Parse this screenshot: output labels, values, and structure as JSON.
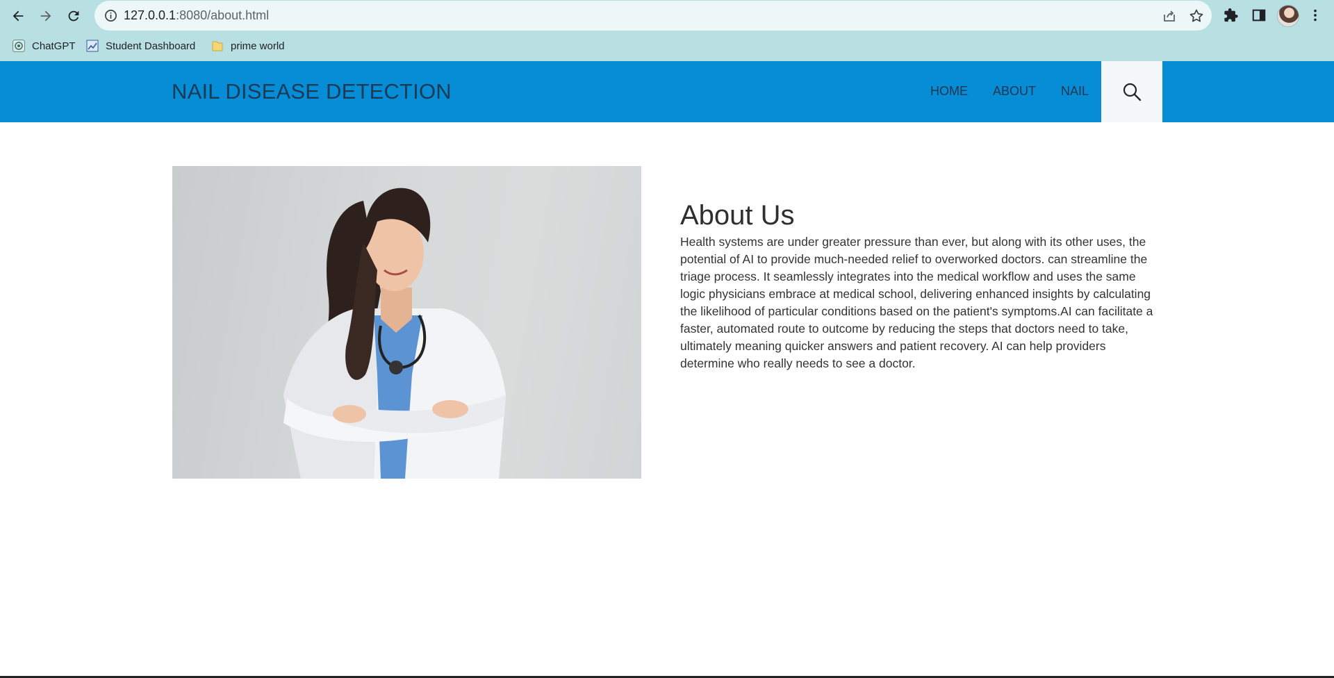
{
  "browser": {
    "url_host": "127.0.0.1",
    "url_path": ":8080/about.html",
    "bookmarks": [
      {
        "label": "ChatGPT",
        "icon": "chatgpt-icon"
      },
      {
        "label": "Student Dashboard",
        "icon": "dashboard-icon"
      },
      {
        "label": "prime world",
        "icon": "folder-icon"
      }
    ]
  },
  "site": {
    "brand": "NAIL DISEASE DETECTION",
    "menu": [
      {
        "label": "HOME"
      },
      {
        "label": "ABOUT"
      },
      {
        "label": "NAIL"
      }
    ],
    "search_icon": "search-icon",
    "header_color": "#068dd6"
  },
  "about": {
    "title": "About Us",
    "body": "Health systems are under greater pressure than ever, but along with its other uses, the potential of AI to provide much-needed relief to overworked doctors. can streamline the triage process. It seamlessly integrates into the medical workflow and uses the same logic physicians embrace at medical school, delivering enhanced insights by calculating the likelihood of particular conditions based on the patient's symptoms.AI can facilitate a faster, automated route to outcome by reducing the steps that doctors need to take, ultimately meaning quicker answers and patient recovery. AI can help providers determine who really needs to see a doctor.",
    "image": "doctor-photo"
  }
}
